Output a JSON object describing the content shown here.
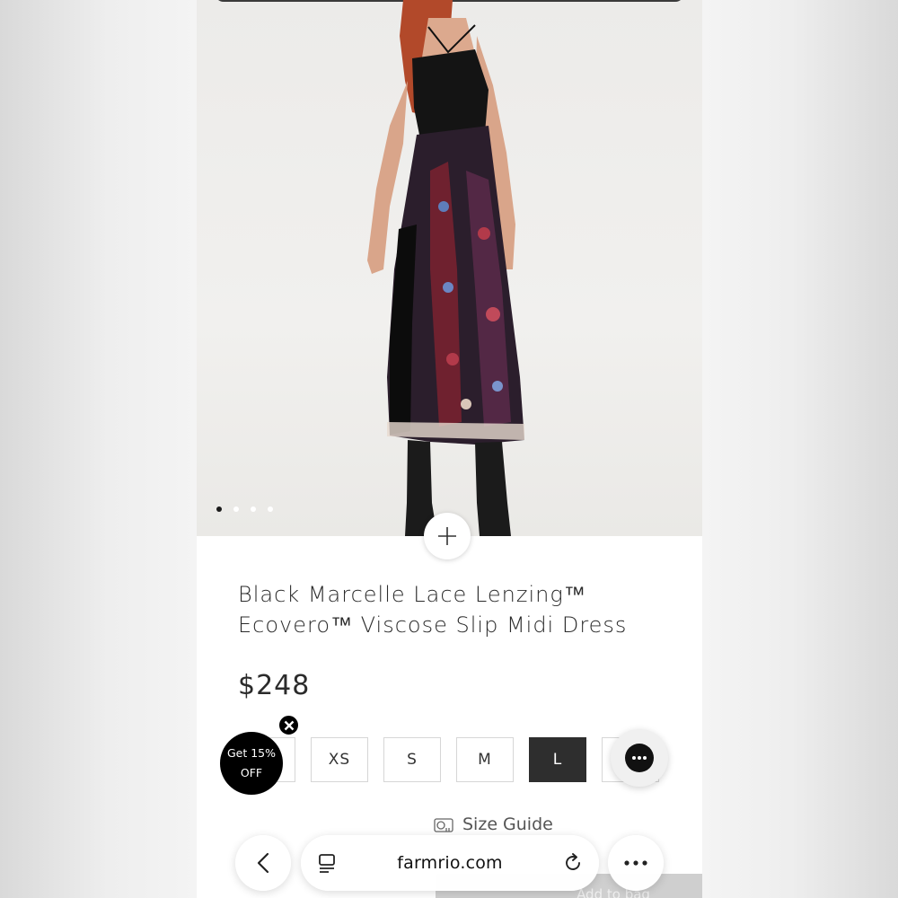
{
  "product": {
    "title": "Black Marcelle Lace Lenzing™ Ecovero™ Viscose Slip Midi Dress",
    "price": "$248"
  },
  "gallery": {
    "dot_count": 4,
    "active_index": 0
  },
  "sizes": [
    {
      "label": "XS"
    },
    {
      "label": "S"
    },
    {
      "label": "M"
    },
    {
      "label": "L",
      "selected": true
    }
  ],
  "promo": {
    "line1": "Get 15%",
    "line2": "OFF"
  },
  "size_guide": {
    "label": "Size Guide"
  },
  "add_to_bag": {
    "label": "Add to bag"
  },
  "browser": {
    "url": "farmrio.com"
  },
  "icons": {
    "zoom": "plus-icon",
    "close": "close-icon",
    "chat": "chat-icon",
    "ruler": "measuring-tape-icon",
    "back": "chevron-left-icon",
    "tabs": "reader-icon",
    "reload": "reload-icon",
    "more": "more-icon",
    "wishlist": "heart-icon"
  },
  "colors": {
    "selected_size_bg": "#2e2e2e",
    "promo_bg": "#000000"
  }
}
